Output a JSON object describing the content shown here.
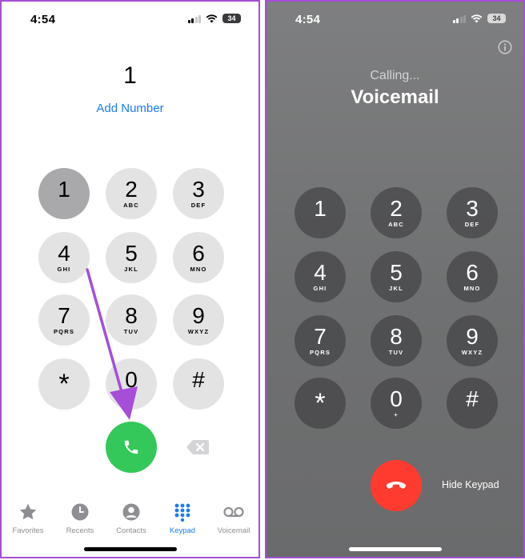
{
  "left_screen": {
    "status": {
      "time": "4:54",
      "battery": "34"
    },
    "dialed_number": "1",
    "add_number_label": "Add Number",
    "keypad": [
      {
        "digit": "1",
        "letters": ""
      },
      {
        "digit": "2",
        "letters": "ABC"
      },
      {
        "digit": "3",
        "letters": "DEF"
      },
      {
        "digit": "4",
        "letters": "GHI"
      },
      {
        "digit": "5",
        "letters": "JKL"
      },
      {
        "digit": "6",
        "letters": "MNO"
      },
      {
        "digit": "7",
        "letters": "PQRS"
      },
      {
        "digit": "8",
        "letters": "TUV"
      },
      {
        "digit": "9",
        "letters": "WXYZ"
      },
      {
        "digit": "*",
        "letters": ""
      },
      {
        "digit": "0",
        "letters": "+"
      },
      {
        "digit": "#",
        "letters": ""
      }
    ],
    "pressed_key": "1",
    "tabs": [
      {
        "label": "Favorites",
        "icon": "star-icon"
      },
      {
        "label": "Recents",
        "icon": "clock-icon"
      },
      {
        "label": "Contacts",
        "icon": "person-circle-icon"
      },
      {
        "label": "Keypad",
        "icon": "keypad-grid-icon",
        "active": true
      },
      {
        "label": "Voicemail",
        "icon": "voicemail-icon"
      }
    ],
    "annotation": "purple arrow pointing from the 4 key to the call button"
  },
  "right_screen": {
    "status": {
      "time": "4:54",
      "battery": "34"
    },
    "calling_status": "Calling...",
    "contact_name": "Voicemail",
    "keypad": [
      {
        "digit": "1",
        "letters": ""
      },
      {
        "digit": "2",
        "letters": "ABC"
      },
      {
        "digit": "3",
        "letters": "DEF"
      },
      {
        "digit": "4",
        "letters": "GHI"
      },
      {
        "digit": "5",
        "letters": "JKL"
      },
      {
        "digit": "6",
        "letters": "MNO"
      },
      {
        "digit": "7",
        "letters": "PQRS"
      },
      {
        "digit": "8",
        "letters": "TUV"
      },
      {
        "digit": "9",
        "letters": "WXYZ"
      },
      {
        "digit": "*",
        "letters": ""
      },
      {
        "digit": "0",
        "letters": "+"
      },
      {
        "digit": "#",
        "letters": ""
      }
    ],
    "hide_keypad_label": "Hide Keypad"
  },
  "colors": {
    "accent_blue": "#1a7bf2",
    "call_green": "#34c759",
    "end_red": "#ff3b30",
    "annotation_purple": "#a64ed8"
  }
}
